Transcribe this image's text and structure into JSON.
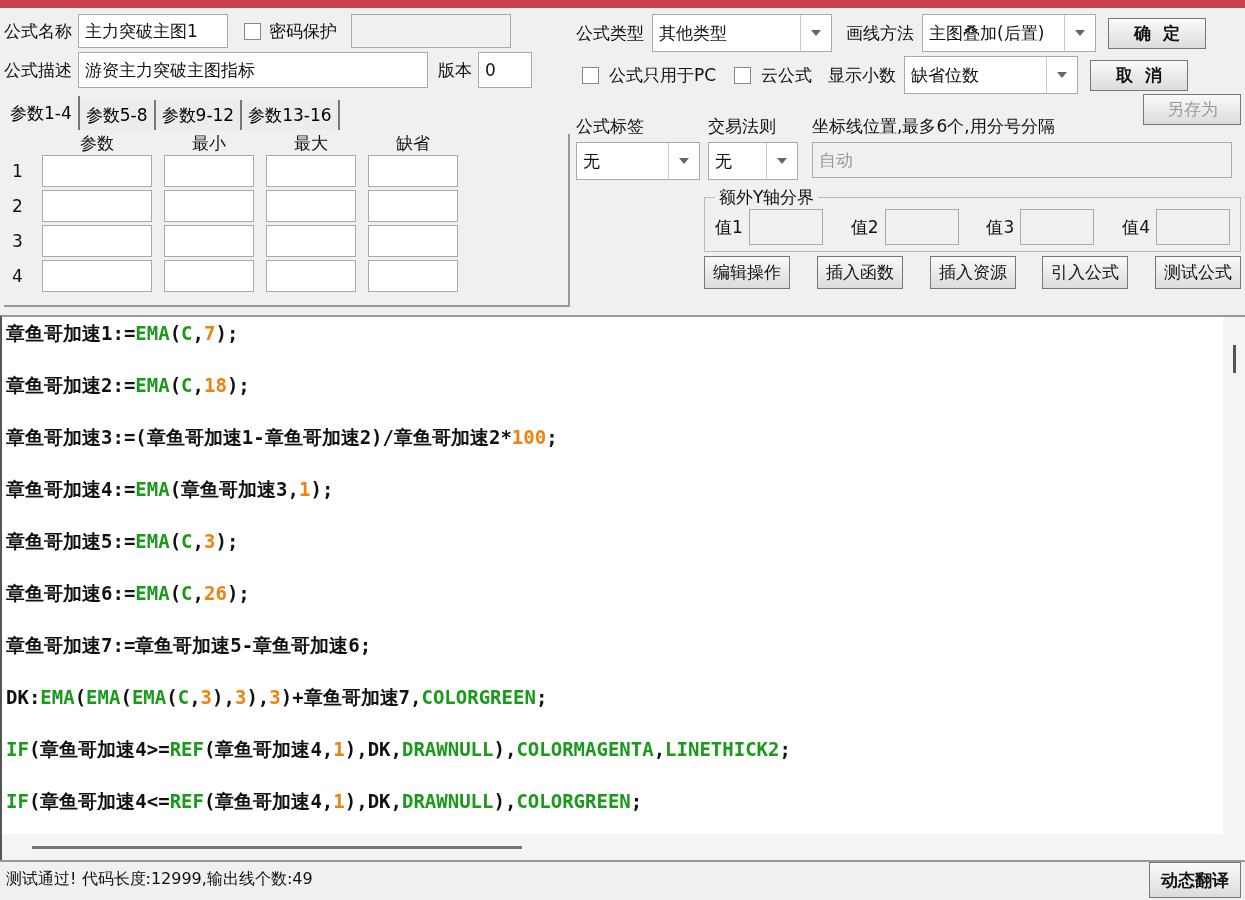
{
  "header": {
    "name_label": "公式名称",
    "name_value": "主力突破主图1",
    "password": {
      "label": "密码保护",
      "checked": false
    },
    "desc_label": "公式描述",
    "desc_value": "游资主力突破主图指标",
    "version_label": "版本",
    "version_value": "0"
  },
  "params": {
    "tabs": [
      {
        "label": "参数1-4",
        "selected": true
      },
      {
        "label": "参数5-8",
        "selected": false
      },
      {
        "label": "参数9-12",
        "selected": false
      },
      {
        "label": "参数13-16",
        "selected": false
      }
    ],
    "columns": [
      "参数",
      "最小",
      "最大",
      "缺省"
    ],
    "rows": [
      "1",
      "2",
      "3",
      "4"
    ]
  },
  "formula_type": {
    "label": "公式类型",
    "value": "其他类型"
  },
  "draw_method": {
    "label": "画线方法",
    "value": "主图叠加(后置)"
  },
  "options": [
    {
      "label": "公式只用于PC",
      "checked": false
    },
    {
      "label": "云公式",
      "checked": false
    }
  ],
  "decimals": {
    "label": "显示小数",
    "value": "缺省位数"
  },
  "buttons": [
    {
      "label": "确  定",
      "disabled": false
    },
    {
      "label": "取  消",
      "disabled": false
    },
    {
      "label": "另存为",
      "disabled": true
    }
  ],
  "tag": {
    "label": "公式标签",
    "value": "无"
  },
  "trade_rule": {
    "label": "交易法则",
    "value": "无"
  },
  "axis_lines": {
    "label": "坐标线位置,最多6个,用分号分隔",
    "value": "自动"
  },
  "extra_y": {
    "title": "额外Y轴分界",
    "fields": [
      "值1",
      "值2",
      "值3",
      "值4"
    ]
  },
  "action_buttons": [
    "编辑操作",
    "插入函数",
    "插入资源",
    "引入公式",
    "测试公式"
  ],
  "code_lines": [
    [
      {
        "kind": "text",
        "text": "章鱼哥加速1:="
      },
      {
        "kind": "keyword",
        "text": "EMA"
      },
      {
        "kind": "text",
        "text": "("
      },
      {
        "kind": "keyword",
        "text": "C"
      },
      {
        "kind": "text",
        "text": ","
      },
      {
        "kind": "number",
        "text": "7"
      },
      {
        "kind": "text",
        "text": ");"
      }
    ],
    [
      {
        "kind": "text",
        "text": "章鱼哥加速2:="
      },
      {
        "kind": "keyword",
        "text": "EMA"
      },
      {
        "kind": "text",
        "text": "("
      },
      {
        "kind": "keyword",
        "text": "C"
      },
      {
        "kind": "text",
        "text": ","
      },
      {
        "kind": "number",
        "text": "18"
      },
      {
        "kind": "text",
        "text": ");"
      }
    ],
    [
      {
        "kind": "text",
        "text": "章鱼哥加速3:=(章鱼哥加速1-章鱼哥加速2)/章鱼哥加速2*"
      },
      {
        "kind": "number",
        "text": "100"
      },
      {
        "kind": "text",
        "text": ";"
      }
    ],
    [
      {
        "kind": "text",
        "text": "章鱼哥加速4:="
      },
      {
        "kind": "keyword",
        "text": "EMA"
      },
      {
        "kind": "text",
        "text": "(章鱼哥加速3,"
      },
      {
        "kind": "number",
        "text": "1"
      },
      {
        "kind": "text",
        "text": ");"
      }
    ],
    [
      {
        "kind": "text",
        "text": "章鱼哥加速5:="
      },
      {
        "kind": "keyword",
        "text": "EMA"
      },
      {
        "kind": "text",
        "text": "("
      },
      {
        "kind": "keyword",
        "text": "C"
      },
      {
        "kind": "text",
        "text": ","
      },
      {
        "kind": "number",
        "text": "3"
      },
      {
        "kind": "text",
        "text": ");"
      }
    ],
    [
      {
        "kind": "text",
        "text": "章鱼哥加速6:="
      },
      {
        "kind": "keyword",
        "text": "EMA"
      },
      {
        "kind": "text",
        "text": "("
      },
      {
        "kind": "keyword",
        "text": "C"
      },
      {
        "kind": "text",
        "text": ","
      },
      {
        "kind": "number",
        "text": "26"
      },
      {
        "kind": "text",
        "text": ");"
      }
    ],
    [
      {
        "kind": "text",
        "text": "章鱼哥加速7:=章鱼哥加速5-章鱼哥加速6;"
      }
    ],
    [
      {
        "kind": "text",
        "text": "DK:"
      },
      {
        "kind": "keyword",
        "text": "EMA"
      },
      {
        "kind": "text",
        "text": "("
      },
      {
        "kind": "keyword",
        "text": "EMA"
      },
      {
        "kind": "text",
        "text": "("
      },
      {
        "kind": "keyword",
        "text": "EMA"
      },
      {
        "kind": "text",
        "text": "("
      },
      {
        "kind": "keyword",
        "text": "C"
      },
      {
        "kind": "text",
        "text": ","
      },
      {
        "kind": "number",
        "text": "3"
      },
      {
        "kind": "text",
        "text": "),"
      },
      {
        "kind": "number",
        "text": "3"
      },
      {
        "kind": "text",
        "text": "),"
      },
      {
        "kind": "number",
        "text": "3"
      },
      {
        "kind": "text",
        "text": ")+章鱼哥加速7,"
      },
      {
        "kind": "keyword",
        "text": "COLORGREEN"
      },
      {
        "kind": "text",
        "text": ";"
      }
    ],
    [
      {
        "kind": "keyword",
        "text": "IF"
      },
      {
        "kind": "text",
        "text": "(章鱼哥加速4>="
      },
      {
        "kind": "keyword",
        "text": "REF"
      },
      {
        "kind": "text",
        "text": "(章鱼哥加速4,"
      },
      {
        "kind": "number",
        "text": "1"
      },
      {
        "kind": "text",
        "text": "),DK,"
      },
      {
        "kind": "keyword",
        "text": "DRAWNULL"
      },
      {
        "kind": "text",
        "text": "),"
      },
      {
        "kind": "keyword",
        "text": "COLORMAGENTA"
      },
      {
        "kind": "text",
        "text": ","
      },
      {
        "kind": "keyword",
        "text": "LINETHICK2"
      },
      {
        "kind": "text",
        "text": ";"
      }
    ],
    [
      {
        "kind": "keyword",
        "text": "IF"
      },
      {
        "kind": "text",
        "text": "(章鱼哥加速4<="
      },
      {
        "kind": "keyword",
        "text": "REF"
      },
      {
        "kind": "text",
        "text": "(章鱼哥加速4,"
      },
      {
        "kind": "number",
        "text": "1"
      },
      {
        "kind": "text",
        "text": "),DK,"
      },
      {
        "kind": "keyword",
        "text": "DRAWNULL"
      },
      {
        "kind": "text",
        "text": "),"
      },
      {
        "kind": "keyword",
        "text": "COLORGREEN"
      },
      {
        "kind": "text",
        "text": ";"
      }
    ]
  ],
  "status": {
    "text": "测试通过! 代码长度:12999,输出线个数:49",
    "button": "动态翻译"
  }
}
